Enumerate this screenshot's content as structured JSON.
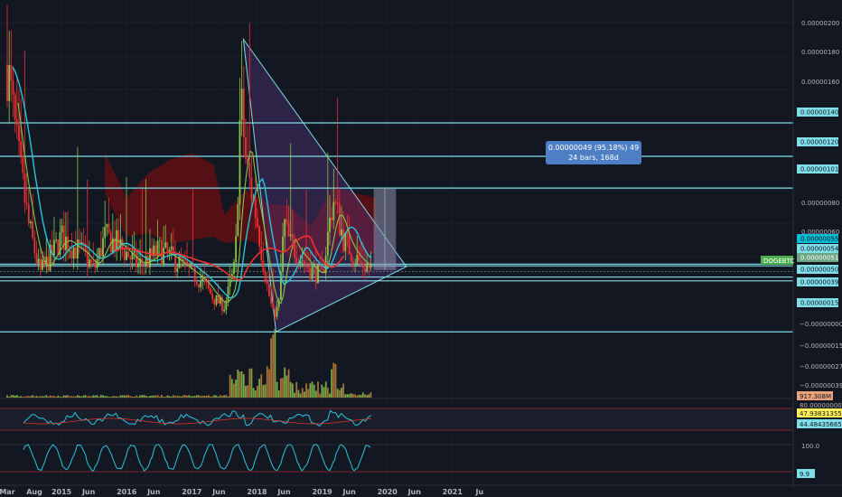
{
  "chart_data": {
    "type": "line",
    "symbol": "DOGEBTC",
    "ylim": [
      0.0,
      2e-06
    ],
    "price_ticks": [
      "0.00000200",
      "0.00000180",
      "0.00000160",
      "0.00000080",
      "0.00000060"
    ],
    "level_tags": [
      {
        "label": "0.00000140",
        "value": 1.4e-06,
        "color": "#7fdde8",
        "text": "#131722"
      },
      {
        "label": "0.00000120",
        "value": 1.2e-06,
        "color": "#7fdde8",
        "text": "#131722"
      },
      {
        "label": "0.00000101",
        "value": 1.01e-06,
        "color": "#7fdde8",
        "text": "#131722"
      },
      {
        "label": "0.00000055",
        "value": 5.55e-07,
        "color": "#00bcd4",
        "text": "#131722"
      },
      {
        "label": "0.00000054",
        "value": 5.45e-07,
        "color": "#7fdde8",
        "text": "#131722"
      },
      {
        "label": "0.00000051",
        "value": 5.1e-07,
        "color": "#6ba583",
        "text": "#ffffff"
      },
      {
        "label": "0.00000050",
        "value": 4.78e-07,
        "color": "#7fdde8",
        "text": "#131722"
      },
      {
        "label": "0.00000039",
        "value": 4.55e-07,
        "color": "#7fdde8",
        "text": "#131722"
      },
      {
        "label": "0.00000015",
        "value": 1.5e-07,
        "color": "#7fdde8",
        "text": "#131722"
      }
    ],
    "lower_ticks": [
      "−0.00000000",
      "−0.00000015",
      "−0.00000027",
      "−0.00000039"
    ],
    "symbol_tag": "DOGEBTC",
    "volume_tag": "917.308M",
    "rsi": {
      "upper_label": "80.00000000",
      "value_label": "47.93831355",
      "lower_value_label": "44.48435665"
    },
    "stoch": {
      "upper_label": "100.0",
      "value_label": "9.9"
    },
    "measure": {
      "line1": "0.00000049 (95.18%) 49",
      "line2": "24 bars, 168d"
    },
    "x_labels": [
      "Mar",
      "Aug",
      "2015",
      "Jun",
      "2016",
      "Jun",
      "2017",
      "Jun",
      "2018",
      "Jun",
      "2019",
      "Jun",
      "2020",
      "Jun",
      "2021",
      "Ju"
    ],
    "colors": {
      "background": "#131722",
      "level": "#7fdde8",
      "ema_fast": "#26c6da",
      "ema_slow": "#ef3131",
      "ma_mid": "#8bc34a",
      "cloud": "#6b0f12",
      "triangle_fill": "#5b3a8a",
      "up": "#8bc34a",
      "down": "#ef3131"
    }
  }
}
